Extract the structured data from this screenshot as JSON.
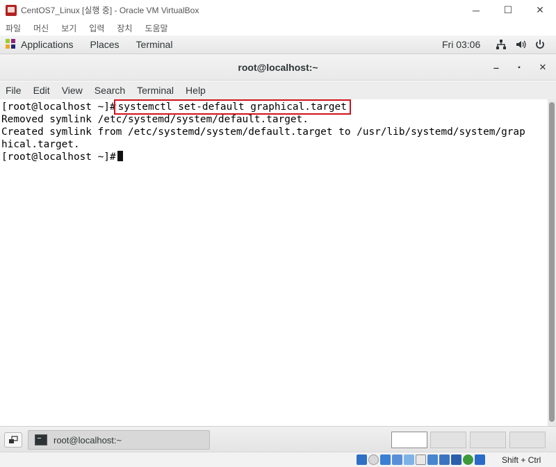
{
  "vbox": {
    "title": "CentOS7_Linux [실행 중] - Oracle VM VirtualBox",
    "controls": {
      "minimize": "─",
      "maximize": "☐",
      "close": "✕"
    },
    "menu": [
      "파일",
      "머신",
      "보기",
      "입력",
      "장치",
      "도움말"
    ],
    "status": {
      "host_key": "Shift + Ctrl"
    }
  },
  "gnome": {
    "applications": "Applications",
    "places": "Places",
    "terminal_app": "Terminal",
    "clock": "Fri 03:06",
    "icons": [
      "network-icon",
      "volume-icon",
      "power-icon"
    ]
  },
  "terminal": {
    "title": "root@localhost:~",
    "controls": {
      "minimize": "‒",
      "maximize": "▪",
      "close": "✕"
    },
    "menu": [
      "File",
      "Edit",
      "View",
      "Search",
      "Terminal",
      "Help"
    ],
    "lines": {
      "prompt1": "[root@localhost ~]#",
      "command": "systemctl set-default graphical.target",
      "out1": "Removed symlink /etc/systemd/system/default.target.",
      "out2": "Created symlink from /etc/systemd/system/default.target to /usr/lib/systemd/system/grap",
      "out3": "hical.target.",
      "prompt2": "[root@localhost ~]#"
    },
    "highlight_color": "#d0121b"
  },
  "taskbar": {
    "task_label": "root@localhost:~",
    "workspaces": 4
  }
}
